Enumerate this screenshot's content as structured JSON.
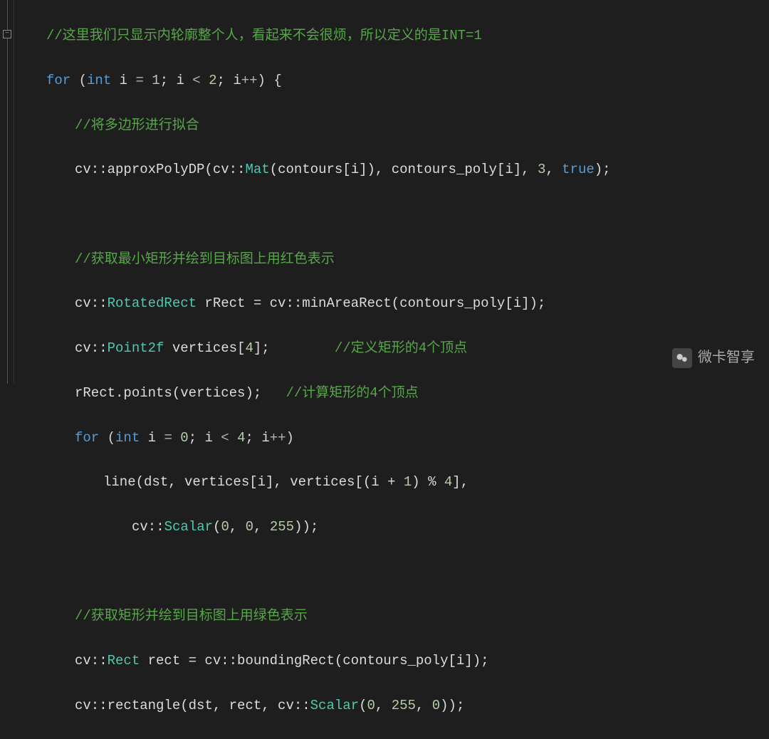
{
  "code": {
    "l1": "//这里我们只显示内轮廓整个人，看起来不会很烦，所以定义的是INT=1",
    "l2_for": "for",
    "l2_int": "int",
    "l2_var": " i ",
    "l2_eq": "= ",
    "l2_n1": "1",
    "l2_semi": "; i ",
    "l2_lt": "< ",
    "l2_n2": "2",
    "l2_semi2": "; i",
    "l2_inc": "++",
    "l2_end": ") {",
    "l3": "//将多边形进行拟合",
    "l4_a": "cv::approxPolyDP(cv::",
    "l4_mat": "Mat",
    "l4_b": "(contours[i]), contours_poly[i], ",
    "l4_n3": "3",
    "l4_c": ", ",
    "l4_true": "true",
    "l4_d": ");",
    "l6": "//获取最小矩形并绘到目标图上用红色表示",
    "l7_a": "cv::",
    "l7_rr": "RotatedRect",
    "l7_b": " rRect = cv::minAreaRect(contours_poly[i]);",
    "l8_a": "cv::",
    "l8_p2f": "Point2f",
    "l8_b": " vertices[",
    "l8_n4": "4",
    "l8_c": "];",
    "l8_pad": "        ",
    "l8_cm": "//定义矩形的4个顶点",
    "l9_a": "rRect.points(vertices);",
    "l9_pad": "   ",
    "l9_cm": "//计算矩形的4个顶点",
    "l10_for": "for",
    "l10_int": "int",
    "l10_a": " i ",
    "l10_eq": "= ",
    "l10_n0": "0",
    "l10_b": "; i ",
    "l10_lt": "< ",
    "l10_n4b": "4",
    "l10_c": "; i",
    "l10_inc": "++",
    "l10_d": ")",
    "l11_a": "line(dst, vertices[i], vertices[(i + ",
    "l11_n1b": "1",
    "l11_b": ") % ",
    "l11_n4c": "4",
    "l11_c": "],",
    "l12_a": "cv::",
    "l12_sc": "Scalar",
    "l12_b": "(",
    "l12_n0a": "0",
    "l12_c": ", ",
    "l12_n0b": "0",
    "l12_d": ", ",
    "l12_n255": "255",
    "l12_e": "));",
    "l14": "//获取矩形并绘到目标图上用绿色表示",
    "l15_a": "cv::",
    "l15_rect": "Rect",
    "l15_b": " rect = cv::boundingRect(contours_poly[i]);",
    "l16_a": "cv::rectangle(dst, rect, cv::",
    "l16_sc": "Scalar",
    "l16_b": "(",
    "l16_n0": "0",
    "l16_c": ", ",
    "l16_n255": "255",
    "l16_d": ", ",
    "l16_n0b": "0",
    "l16_e": "));"
  },
  "watermark": {
    "text": "微卡智享"
  }
}
